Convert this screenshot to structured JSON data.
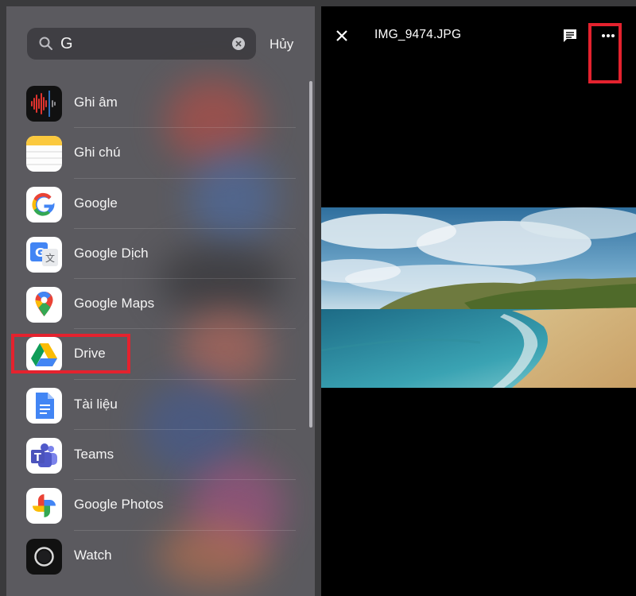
{
  "search": {
    "query": "G",
    "cancel_label": "Hủy"
  },
  "apps": [
    {
      "label": "Ghi âm",
      "icon": "voice-memos-icon"
    },
    {
      "label": "Ghi chú",
      "icon": "notes-icon"
    },
    {
      "label": "Google",
      "icon": "google-icon"
    },
    {
      "label": "Google Dịch",
      "icon": "google-translate-icon"
    },
    {
      "label": "Google Maps",
      "icon": "google-maps-icon"
    },
    {
      "label": "Drive",
      "icon": "google-drive-icon"
    },
    {
      "label": "Tài liệu",
      "icon": "google-docs-icon"
    },
    {
      "label": "Teams",
      "icon": "teams-icon"
    },
    {
      "label": "Google Photos",
      "icon": "google-photos-icon"
    },
    {
      "label": "Watch",
      "icon": "watch-icon"
    }
  ],
  "viewer": {
    "file_name": "IMG_9474.JPG",
    "close_icon": "close-icon",
    "comment_icon": "comment-icon",
    "more_icon": "more-dots-icon"
  },
  "colors": {
    "highlight": "#e4222e",
    "viewer_bg": "#000000"
  }
}
